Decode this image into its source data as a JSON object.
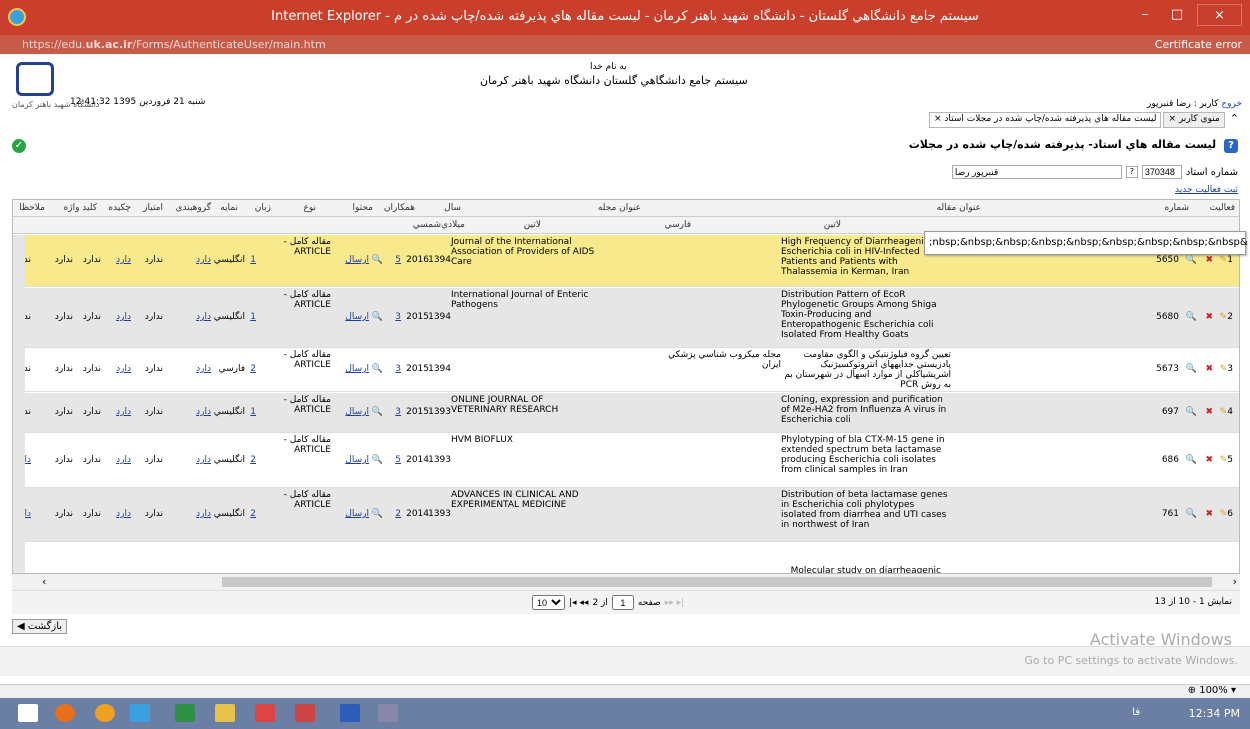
{
  "window": {
    "title": "Internet Explorer - سيستم جامع دانشگاهي گلستان - دانشگاه شهيد باهنر کرمان - ليست مقاله هاي پذيرفته شده/چاپ شده در م",
    "close": "×",
    "max": "□",
    "min": "–"
  },
  "address": {
    "prefix": "https://edu.",
    "host": "uk.ac.ir",
    "path": "/Forms/AuthenticateUser/main.htm",
    "cert": "Certificate error"
  },
  "header": {
    "basmala": "به نام خدا",
    "system_name": "سيستم جامع دانشگاهي گلستان   دانشگاه شهيد باهنر کرمان",
    "datetime": "12:41:32 شنبه 21 فروردين 1395",
    "logo_caption": "دانشگاه شهید باهنر کرمان",
    "user_label": "کاربر : رضا قنبرپور",
    "logout": "خروج"
  },
  "tabs": [
    {
      "label": "منوي کاربر"
    },
    {
      "label": "ليست مقاله هاي پذيرفته شده/چاپ شده در مجلات استاد"
    }
  ],
  "page": {
    "heading": "ليست مقاله هاي استاد- پذيرفته شده/چاپ شده در مجلات",
    "prof_label": "شماره استاد",
    "prof_number": "370348",
    "prof_name": "قنبرپور رضا",
    "new_activity": "ثبت فعاليت جديد"
  },
  "table": {
    "headers": {
      "activity": "فعاليت",
      "number": "شماره",
      "article_title": "عنوان مقاله",
      "latin": "لاتين",
      "journal_title": "عنوان مجله",
      "farsi": "فارسي",
      "journal_latin": "لاتين",
      "year": "سال",
      "solar": "شمسي",
      "gregorian": "ميلادي",
      "coauthors": "همکاران",
      "content": "محتوا",
      "type": "نوع",
      "language": "زبان",
      "index": "نمايه",
      "group": "گروهبندي",
      "points": "امتياز",
      "abstract": "چکيده",
      "keywords": "کليد واژه",
      "notes": "ملاحظا"
    },
    "tooltip": ";nbsp;&nbsp;&nbsp;&nbsp;&nbsp;&nbsp;&nbsp;&nbsp;&nbsp&",
    "rows": [
      {
        "idx": "1",
        "num": "5650",
        "title": "High Frequency of Diarrheageni Escherichia coli in HIV-Infected Patients and Patients with Thalassemia in Kerman, Iran",
        "journal_fa": "",
        "journal": "Journal of the International Association of Providers of AIDS Care",
        "solar": "1394",
        "greg": "2016",
        "co": "5",
        "send": "ارسال",
        "type": "مقاله کامل - ARTICLE",
        "lang": "انگليسي",
        "lnum": "1",
        "has": "دارد",
        "none": "ندارد",
        "notes": "ندا"
      },
      {
        "idx": "2",
        "num": "5680",
        "title": "Distribution Pattern of EcoR Phylogenetic Groups Among Shiga Toxin-Producing and Enteropathogenic Escherichia coli Isolated From Healthy Goats",
        "journal_fa": "",
        "journal": "International Journal of Enteric Pathogens",
        "solar": "1394",
        "greg": "2015",
        "co": "3",
        "send": "ارسال",
        "type": "مقاله کامل - ARTICLE",
        "lang": "انگليسي",
        "lnum": "1",
        "has": "دارد",
        "none": "ندارد",
        "notes": "ندا"
      },
      {
        "idx": "3",
        "num": "5673",
        "title": "تعيين گروه فيلوژنتيکي و الگوي مقاومت پادزيستي جدايههاي انتروتوکسيژنيک اشريشياکلي از موارد اسهال در شهرستان بم به روش PCR",
        "journal_fa": "مجله ميکروب شناسي پزشکي ايران",
        "journal": "",
        "solar": "1394",
        "greg": "2015",
        "co": "3",
        "send": "ارسال",
        "type": "مقاله کامل - ARTICLE",
        "lang": "فارسي",
        "lnum": "2",
        "has": "دارد",
        "none": "ندارد",
        "notes": "ندا"
      },
      {
        "idx": "4",
        "num": "697",
        "title": "Cloning, expression and purification of M2e-HA2 from Influenza A virus in Escherichia coli",
        "journal_fa": "",
        "journal": "ONLINE JOURNAL OF VETERINARY RESEARCH",
        "solar": "1393",
        "greg": "2015",
        "co": "3",
        "send": "ارسال",
        "type": "مقاله کامل - ARTICLE",
        "lang": "انگليسي",
        "lnum": "1",
        "has": "دارد",
        "none": "ندارد",
        "notes": "ندا"
      },
      {
        "idx": "5",
        "num": "686",
        "title": "Phylotyping of bla CTX-M-15 gene in extended spectrum beta lactamase producing Escherichia coli isolates from clinical samples in Iran",
        "journal_fa": "",
        "journal": "HVM BIOFLUX",
        "solar": "1393",
        "greg": "2014",
        "co": "5",
        "send": "ارسال",
        "type": "مقاله کامل - ARTICLE",
        "lang": "انگليسي",
        "lnum": "2",
        "has": "دارد",
        "none": "ندارد",
        "notes": "دارد"
      },
      {
        "idx": "6",
        "num": "761",
        "title": "Distribution of beta lactamase genes in Escherichia coli phylotypes isolated from diarrhea and UTI cases in northwest of Iran",
        "journal_fa": "",
        "journal": "ADVANCES IN CLINICAL AND EXPERIMENTAL MEDICINE",
        "solar": "1393",
        "greg": "2014",
        "co": "2",
        "send": "ارسال",
        "type": "مقاله کامل - ARTICLE",
        "lang": "انگليسي",
        "lnum": "2",
        "has": "دارد",
        "none": "ندارد",
        "notes": "دارد"
      }
    ],
    "partial_row": "Molecular study on diarrheagenic"
  },
  "pager": {
    "page_size": "10",
    "page_label": "صفحه",
    "page": "1",
    "of": "از 2",
    "summary": "نمايش 1 - 10 از 13"
  },
  "back": "بازگشت",
  "watermark": {
    "line1": "Activate Windows",
    "line2": "Go to PC settings to activate Windows."
  },
  "status": {
    "zoom": "100%"
  },
  "taskbar": {
    "time": "12:34 PM",
    "lang": "فا"
  }
}
